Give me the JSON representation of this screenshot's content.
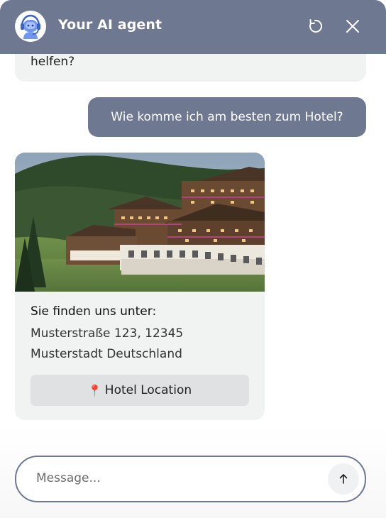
{
  "header": {
    "title": "Your AI agent",
    "avatar_icon": "robot-headset-icon",
    "restart_icon": "restart-icon",
    "close_icon": "close-icon",
    "background_color": "#6e7890"
  },
  "messages": [
    {
      "role": "bot",
      "text": "helfen?"
    },
    {
      "role": "user",
      "text": "Wie komme ich am besten zum Hotel?"
    },
    {
      "role": "bot",
      "type": "card",
      "image": "hotel-photo",
      "heading": "Sie finden uns unter:",
      "address_line1": "Musterstraße 123, 12345",
      "address_line2": "Musterstadt Deutschland",
      "button": {
        "icon": "map-pin-icon",
        "pin_glyph": "📍",
        "label": "Hotel Location"
      }
    }
  ],
  "composer": {
    "placeholder": "Message...",
    "value": "",
    "send_icon": "arrow-up-icon"
  },
  "colors": {
    "accent": "#6e7890",
    "bubble_bg": "#f1f2f2",
    "button_bg": "#e0e1e3"
  }
}
